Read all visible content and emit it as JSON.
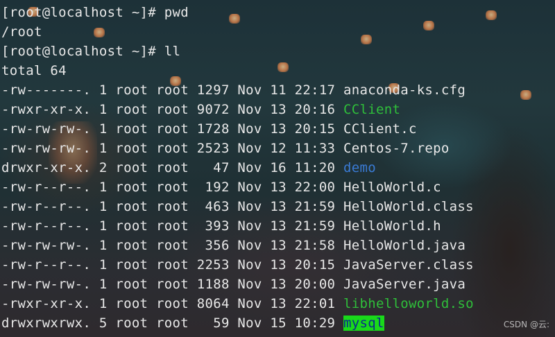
{
  "colors": {
    "directory": "#3a7bd5",
    "executable": "#2fbf3a",
    "highlight_bg": "#19d91a",
    "text": "#e8e8e8"
  },
  "terminal": {
    "lines": [
      {
        "prefix": "[root@localhost ~]# pwd",
        "name": "",
        "kind": "plain"
      },
      {
        "prefix": "/root",
        "name": "",
        "kind": "plain"
      },
      {
        "prefix": "[root@localhost ~]# ll",
        "name": "",
        "kind": "plain"
      },
      {
        "prefix": "total 64",
        "name": "",
        "kind": "plain"
      },
      {
        "prefix": "-rw-------. 1 root root 1297 Nov 11 22:17 ",
        "name": "anaconda-ks.cfg",
        "kind": "file"
      },
      {
        "prefix": "-rwxr-xr-x. 1 root root 9072 Nov 13 20:16 ",
        "name": "CClient",
        "kind": "exec"
      },
      {
        "prefix": "-rw-rw-rw-. 1 root root 1728 Nov 13 20:15 ",
        "name": "CClient.c",
        "kind": "file"
      },
      {
        "prefix": "-rw-rw-rw-. 1 root root 2523 Nov 12 11:33 ",
        "name": "Centos-7.repo",
        "kind": "file"
      },
      {
        "prefix": "drwxr-xr-x. 2 root root   47 Nov 16 11:20 ",
        "name": "demo",
        "kind": "dir"
      },
      {
        "prefix": "-rw-r--r--. 1 root root  192 Nov 13 22:00 ",
        "name": "HelloWorld.c",
        "kind": "file"
      },
      {
        "prefix": "-rw-r--r--. 1 root root  463 Nov 13 21:59 ",
        "name": "HelloWorld.class",
        "kind": "file"
      },
      {
        "prefix": "-rw-r--r--. 1 root root  393 Nov 13 21:59 ",
        "name": "HelloWorld.h",
        "kind": "file"
      },
      {
        "prefix": "-rw-rw-rw-. 1 root root  356 Nov 13 21:58 ",
        "name": "HelloWorld.java",
        "kind": "file"
      },
      {
        "prefix": "-rw-r--r--. 1 root root 2253 Nov 13 20:15 ",
        "name": "JavaServer.class",
        "kind": "file"
      },
      {
        "prefix": "-rw-rw-rw-. 1 root root 1188 Nov 13 20:00 ",
        "name": "JavaServer.java",
        "kind": "file"
      },
      {
        "prefix": "-rwxr-xr-x. 1 root root 8064 Nov 13 22:01 ",
        "name": "libhelloworld.so",
        "kind": "exec"
      },
      {
        "prefix": "drwxrwxrwx. 5 root root   59 Nov 15 10:29 ",
        "name": "mysql",
        "kind": "highlight"
      }
    ]
  },
  "watermark": "CSDN @云:"
}
